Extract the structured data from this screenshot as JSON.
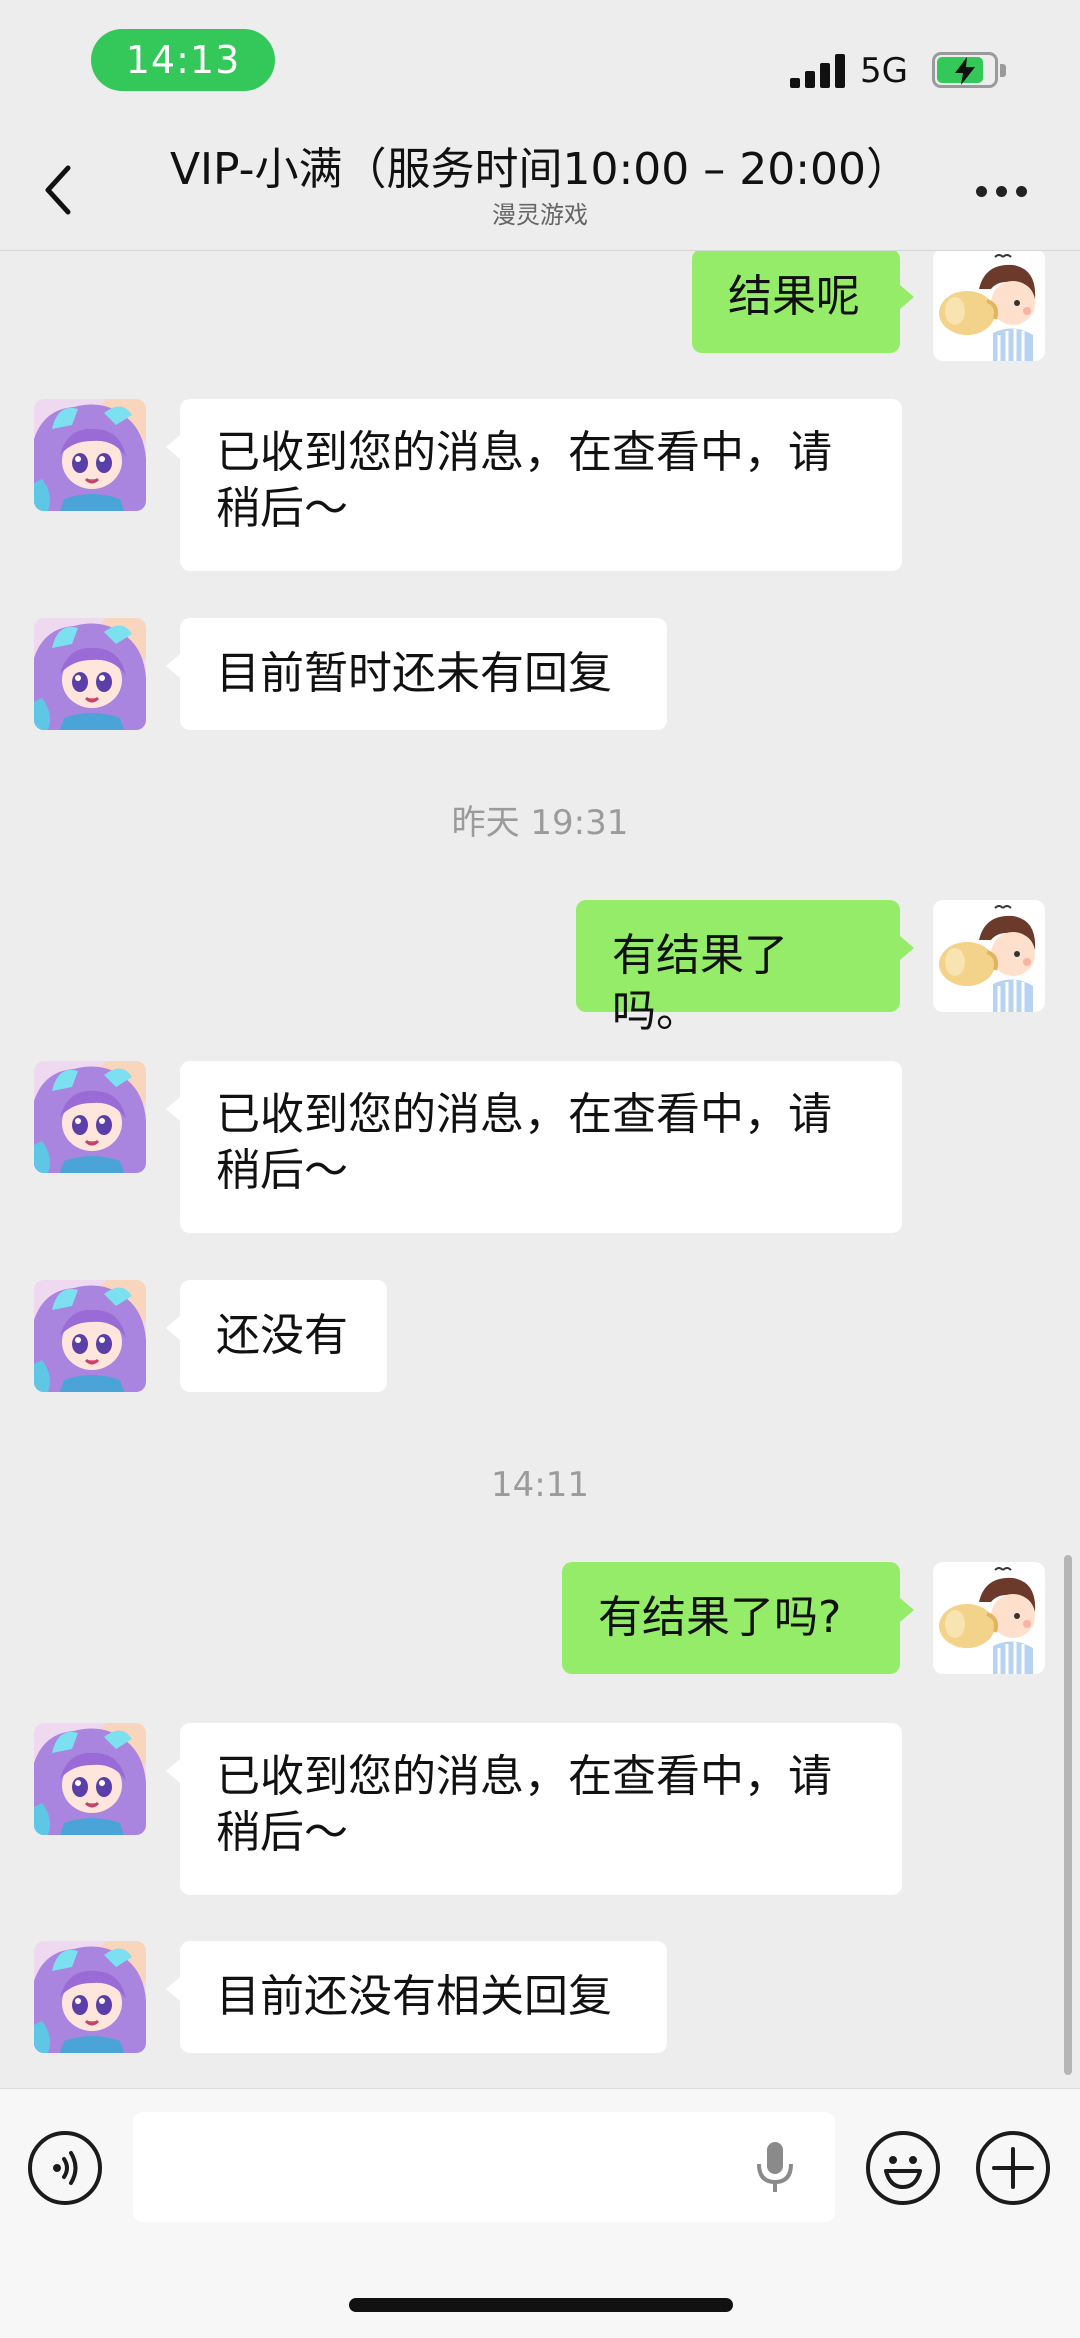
{
  "status_bar": {
    "time": "14:13",
    "network": "5G",
    "battery_charging": true
  },
  "nav": {
    "title": "VIP-小满（服务时间10:00 – 20:00）",
    "subtitle": "漫灵游戏"
  },
  "messages": [
    {
      "from": "me",
      "text": "结果呢"
    },
    {
      "from": "agent",
      "text_line1": "已收到您的消息，在查看中，请",
      "text_line2": "稍后～"
    },
    {
      "from": "agent",
      "text": "目前暂时还未有回复"
    },
    {
      "timestamp": "昨天 19:31"
    },
    {
      "from": "me",
      "text": "有结果了吗。"
    },
    {
      "from": "agent",
      "text_line1": "已收到您的消息，在查看中，请",
      "text_line2": "稍后～"
    },
    {
      "from": "agent",
      "text": "还没有"
    },
    {
      "timestamp": "14:11"
    },
    {
      "from": "me",
      "text": "有结果了吗?"
    },
    {
      "from": "agent",
      "text_line1": "已收到您的消息，在查看中，请",
      "text_line2": "稍后～"
    },
    {
      "from": "agent",
      "text": "目前还没有相关回复"
    }
  ],
  "input_bar": {
    "voice_icon": "voice-toggle-icon",
    "mic_icon": "microphone-icon",
    "emoji_icon": "emoji-icon",
    "plus_icon": "plus-icon",
    "input_value": ""
  },
  "colors": {
    "background": "#ededed",
    "outgoing_bubble": "#95ec69",
    "incoming_bubble": "#ffffff",
    "time_pill": "#34c759"
  }
}
